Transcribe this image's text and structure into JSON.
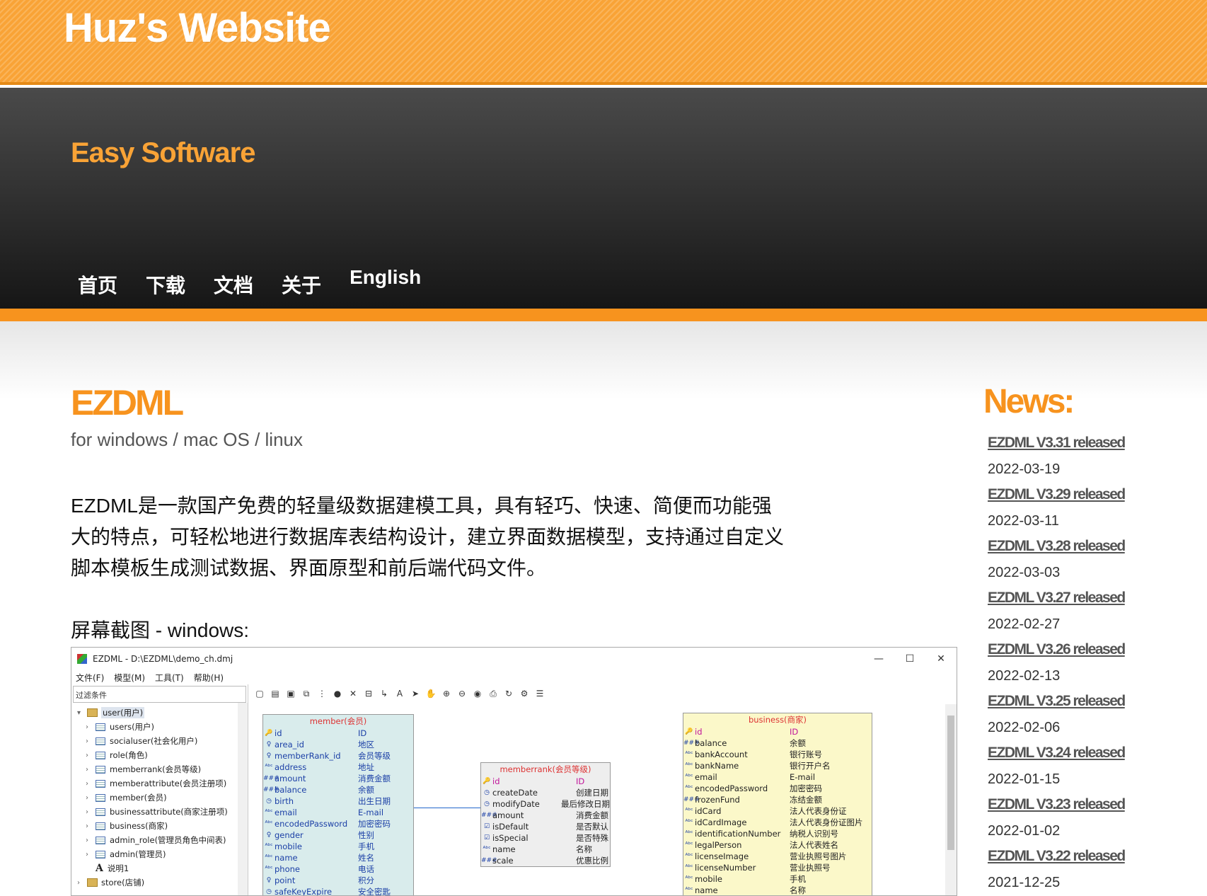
{
  "site": {
    "title": "Huz's Website",
    "tagline": "Easy Software"
  },
  "nav": [
    {
      "label": "首页"
    },
    {
      "label": "下载"
    },
    {
      "label": "文档"
    },
    {
      "label": "关于"
    },
    {
      "label": "English"
    }
  ],
  "main": {
    "title": "EZDML",
    "platforms": "for windows / mac OS / linux",
    "description": "EZDML是一款国产免费的轻量级数据建模工具，具有轻巧、快速、简便而功能强大的特点，可轻松地进行数据库表结构设计，建立界面数据模型，支持通过自定义脚本模板生成测试数据、界面原型和前后端代码文件。",
    "screenshot_heading": "屏幕截图 - windows:"
  },
  "app": {
    "window_title": "EZDML - D:\\EZDML\\demo_ch.dmj",
    "controls": [
      "—",
      "☐",
      "✕"
    ],
    "menus": [
      {
        "label": "文件(F)"
      },
      {
        "label": "模型(M)"
      },
      {
        "label": "工具(T)"
      },
      {
        "label": "帮助(H)"
      }
    ],
    "filter_label": "过滤条件",
    "tree": {
      "root": "user(用户)",
      "children": [
        "users(用户)",
        "socialuser(社会化用户)",
        "role(角色)",
        "memberrank(会员等级)",
        "memberattribute(会员注册项)",
        "member(会员)",
        "businessattribute(商家注册项)",
        "business(商家)",
        "admin_role(管理员角色中间表)",
        "admin(管理员)"
      ],
      "note": "说明1",
      "store": "store(店铺)"
    },
    "entities": {
      "member": {
        "title": "member(会员)",
        "fields": [
          {
            "icon": "key-icon",
            "name": "id",
            "label": "ID"
          },
          {
            "icon": "fk-icon",
            "name": "area_id",
            "label": "地区"
          },
          {
            "icon": "fk-icon",
            "name": "memberRank_id",
            "label": "会员等级"
          },
          {
            "icon": "text-icon",
            "name": "address",
            "label": "地址"
          },
          {
            "icon": "number-icon",
            "name": "amount",
            "label": "消费金额"
          },
          {
            "icon": "number-icon",
            "name": "balance",
            "label": "余额"
          },
          {
            "icon": "date-icon",
            "name": "birth",
            "label": "出生日期"
          },
          {
            "icon": "text-icon",
            "name": "email",
            "label": "E-mail"
          },
          {
            "icon": "text-icon",
            "name": "encodedPassword",
            "label": "加密密码"
          },
          {
            "icon": "fk-icon",
            "name": "gender",
            "label": "性别"
          },
          {
            "icon": "text-icon",
            "name": "mobile",
            "label": "手机"
          },
          {
            "icon": "text-icon",
            "name": "name",
            "label": "姓名"
          },
          {
            "icon": "text-icon",
            "name": "phone",
            "label": "电话"
          },
          {
            "icon": "fk-icon",
            "name": "point",
            "label": "积分"
          },
          {
            "icon": "date-icon",
            "name": "safeKeyExpire",
            "label": "安全密匙"
          }
        ]
      },
      "rank": {
        "title": "memberrank(会员等级)",
        "fields": [
          {
            "icon": "key-icon",
            "name": "id",
            "label": "ID"
          },
          {
            "icon": "date-icon",
            "name": "createDate",
            "label": "创建日期"
          },
          {
            "icon": "date-icon",
            "name": "modifyDate",
            "label": "最后修改日期"
          },
          {
            "icon": "number-icon",
            "name": "amount",
            "label": "消费金额"
          },
          {
            "icon": "checkbox-icon",
            "name": "isDefault",
            "label": "是否默认"
          },
          {
            "icon": "checkbox-icon",
            "name": "isSpecial",
            "label": "是否特殊"
          },
          {
            "icon": "text-icon",
            "name": "name",
            "label": "名称"
          },
          {
            "icon": "number-icon",
            "name": "scale",
            "label": "优惠比例"
          }
        ]
      },
      "business": {
        "title": "business(商家)",
        "fields": [
          {
            "icon": "key-icon",
            "name": "id",
            "label": "ID"
          },
          {
            "icon": "number-icon",
            "name": "balance",
            "label": "余额"
          },
          {
            "icon": "text-icon",
            "name": "bankAccount",
            "label": "银行账号"
          },
          {
            "icon": "text-icon",
            "name": "bankName",
            "label": "银行开户名"
          },
          {
            "icon": "text-icon",
            "name": "email",
            "label": "E-mail"
          },
          {
            "icon": "text-icon",
            "name": "encodedPassword",
            "label": "加密密码"
          },
          {
            "icon": "number-icon",
            "name": "frozenFund",
            "label": "冻结金额"
          },
          {
            "icon": "text-icon",
            "name": "idCard",
            "label": "法人代表身份证"
          },
          {
            "icon": "text-icon",
            "name": "idCardImage",
            "label": "法人代表身份证图片"
          },
          {
            "icon": "text-icon",
            "name": "identificationNumber",
            "label": "纳税人识别号"
          },
          {
            "icon": "text-icon",
            "name": "legalPerson",
            "label": "法人代表姓名"
          },
          {
            "icon": "text-icon",
            "name": "licenseImage",
            "label": "营业执照号图片"
          },
          {
            "icon": "text-icon",
            "name": "licenseNumber",
            "label": "营业执照号"
          },
          {
            "icon": "text-icon",
            "name": "mobile",
            "label": "手机"
          },
          {
            "icon": "text-icon",
            "name": "name",
            "label": "名称"
          }
        ]
      }
    }
  },
  "news": {
    "heading": "News:",
    "items": [
      {
        "title": "EZDML V3.31 released",
        "date": "2022-03-19"
      },
      {
        "title": "EZDML V3.29 released",
        "date": "2022-03-11"
      },
      {
        "title": "EZDML V3.28 released",
        "date": "2022-03-03"
      },
      {
        "title": "EZDML V3.27 released",
        "date": "2022-02-27"
      },
      {
        "title": "EZDML V3.26 released",
        "date": "2022-02-13"
      },
      {
        "title": "EZDML V3.25 released",
        "date": "2022-02-06"
      },
      {
        "title": "EZDML V3.24 released",
        "date": "2022-01-15"
      },
      {
        "title": "EZDML V3.23 released",
        "date": "2022-01-02"
      },
      {
        "title": "EZDML V3.22 released",
        "date": "2021-12-25"
      }
    ]
  },
  "colors": {
    "orange": "#f7931e",
    "banner": "#f9a336",
    "link": "#555555"
  }
}
